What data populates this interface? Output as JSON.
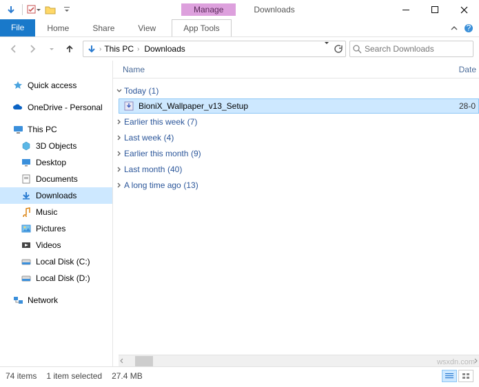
{
  "window": {
    "title": "Downloads",
    "contextual_tab_group": "Manage",
    "contextual_tab": "App Tools"
  },
  "ribbon": {
    "file": "File",
    "tabs": [
      "Home",
      "Share",
      "View"
    ]
  },
  "nav": {
    "breadcrumbs": [
      "This PC",
      "Downloads"
    ],
    "search_placeholder": "Search Downloads"
  },
  "tree": {
    "quick_access": "Quick access",
    "onedrive": "OneDrive - Personal",
    "this_pc": "This PC",
    "children": [
      "3D Objects",
      "Desktop",
      "Documents",
      "Downloads",
      "Music",
      "Pictures",
      "Videos",
      "Local Disk (C:)",
      "Local Disk (D:)"
    ],
    "network": "Network"
  },
  "columns": {
    "name": "Name",
    "date": "Date"
  },
  "groups": [
    {
      "label": "Today",
      "count": "(1)",
      "expanded": true,
      "files": [
        {
          "name": "BioniX_Wallpaper_v13_Setup",
          "date": "28-0"
        }
      ]
    },
    {
      "label": "Earlier this week",
      "count": "(7)",
      "expanded": false
    },
    {
      "label": "Last week",
      "count": "(4)",
      "expanded": false
    },
    {
      "label": "Earlier this month",
      "count": "(9)",
      "expanded": false
    },
    {
      "label": "Last month",
      "count": "(40)",
      "expanded": false
    },
    {
      "label": "A long time ago",
      "count": "(13)",
      "expanded": false
    }
  ],
  "status": {
    "items": "74 items",
    "selection": "1 item selected",
    "size": "27.4 MB"
  },
  "watermark": "wsxdn.com"
}
